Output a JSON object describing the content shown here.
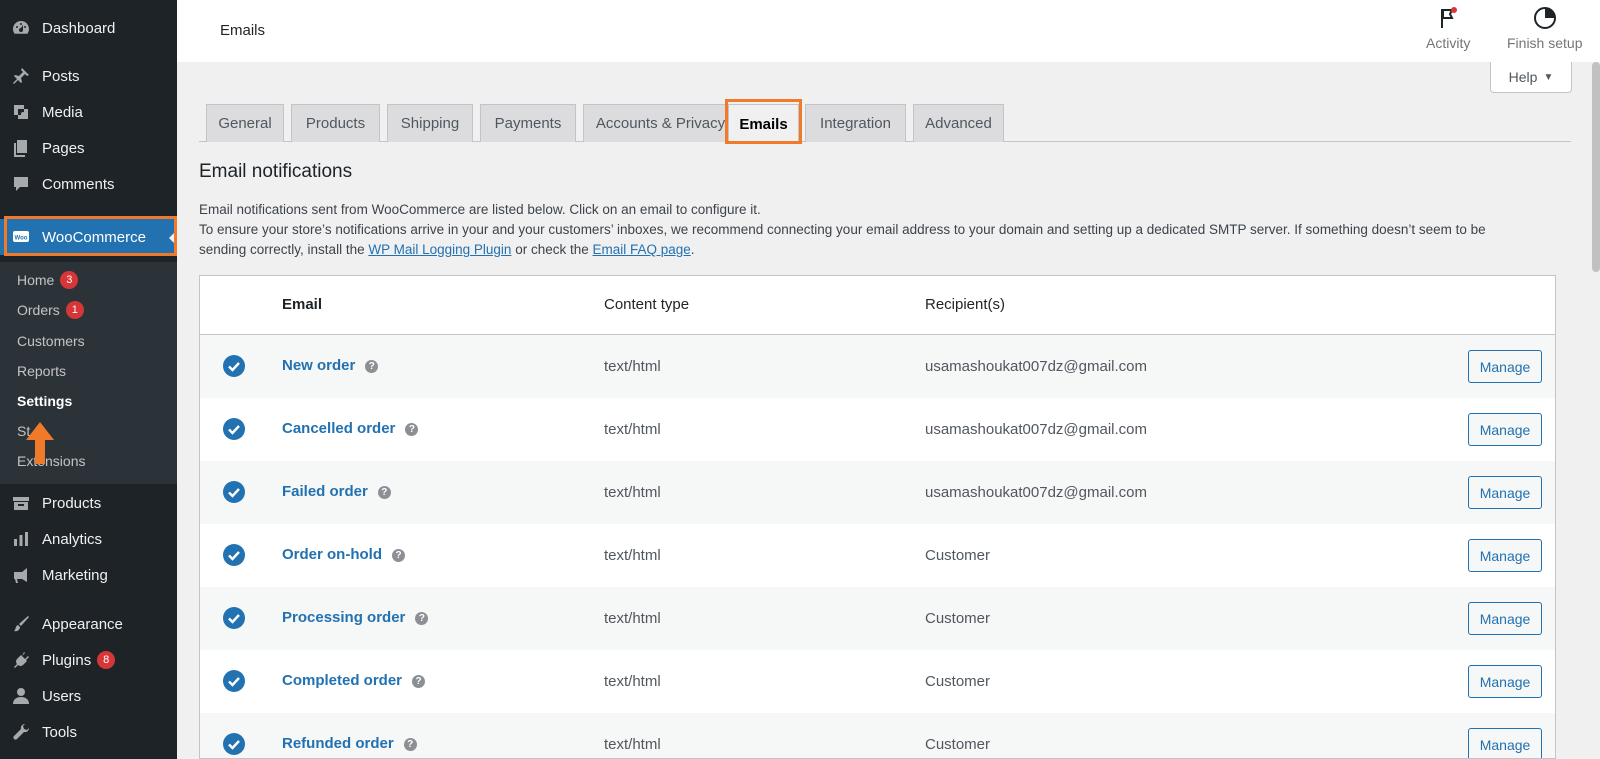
{
  "sidebar": {
    "items": [
      {
        "label": "Dashboard",
        "icon": "dashboard-icon"
      },
      {
        "label": "Posts",
        "icon": "pin-icon"
      },
      {
        "label": "Media",
        "icon": "media-icon"
      },
      {
        "label": "Pages",
        "icon": "pages-icon"
      },
      {
        "label": "Comments",
        "icon": "comment-icon"
      },
      {
        "label": "WooCommerce",
        "icon": "woocommerce-icon"
      },
      {
        "label": "Products",
        "icon": "archive-icon"
      },
      {
        "label": "Analytics",
        "icon": "chart-bar-icon"
      },
      {
        "label": "Marketing",
        "icon": "megaphone-icon"
      },
      {
        "label": "Appearance",
        "icon": "paintbrush-icon"
      },
      {
        "label": "Plugins",
        "icon": "plugin-icon",
        "badge": "8"
      },
      {
        "label": "Users",
        "icon": "user-icon"
      },
      {
        "label": "Tools",
        "icon": "wrench-icon"
      }
    ],
    "submenu": [
      {
        "label": "Home",
        "badge": "3"
      },
      {
        "label": "Orders",
        "badge": "1"
      },
      {
        "label": "Customers"
      },
      {
        "label": "Reports"
      },
      {
        "label": "Settings"
      },
      {
        "label": "St"
      },
      {
        "label": "Extensions"
      }
    ]
  },
  "header": {
    "title": "Emails",
    "activity_label": "Activity",
    "finish_setup_label": "Finish setup"
  },
  "help": {
    "label": "Help"
  },
  "tabs": [
    {
      "label": "General"
    },
    {
      "label": "Products"
    },
    {
      "label": "Shipping"
    },
    {
      "label": "Payments"
    },
    {
      "label": "Accounts & Privacy"
    },
    {
      "label": "Emails"
    },
    {
      "label": "Integration"
    },
    {
      "label": "Advanced"
    }
  ],
  "section": {
    "title": "Email notifications",
    "desc1": "Email notifications sent from WooCommerce are listed below. Click on an email to configure it.",
    "desc2": "To ensure your store’s notifications arrive in your and your customers’ inboxes, we recommend connecting your email address to your domain and setting up a dedicated SMTP server. If something doesn’t seem to be",
    "desc3_pre": "sending correctly, install the ",
    "desc3_link1": "WP Mail Logging Plugin",
    "desc3_mid": " or check the ",
    "desc3_link2": "Email FAQ page",
    "desc3_post": "."
  },
  "table": {
    "headers": {
      "email": "Email",
      "content_type": "Content type",
      "recipients": "Recipient(s)"
    },
    "rows": [
      {
        "name": "New order",
        "content_type": "text/html",
        "recipient": "usamashoukat007dz@gmail.com",
        "action": "Manage"
      },
      {
        "name": "Cancelled order",
        "content_type": "text/html",
        "recipient": "usamashoukat007dz@gmail.com",
        "action": "Manage"
      },
      {
        "name": "Failed order",
        "content_type": "text/html",
        "recipient": "usamashoukat007dz@gmail.com",
        "action": "Manage"
      },
      {
        "name": "Order on-hold",
        "content_type": "text/html",
        "recipient": "Customer",
        "action": "Manage"
      },
      {
        "name": "Processing order",
        "content_type": "text/html",
        "recipient": "Customer",
        "action": "Manage"
      },
      {
        "name": "Completed order",
        "content_type": "text/html",
        "recipient": "Customer",
        "action": "Manage"
      },
      {
        "name": "Refunded order",
        "content_type": "text/html",
        "recipient": "Customer",
        "action": "Manage"
      }
    ]
  },
  "colors": {
    "accent": "#2271b1",
    "highlight": "#f0792a",
    "sidebar": "#1d2327",
    "badge": "#d63638"
  }
}
